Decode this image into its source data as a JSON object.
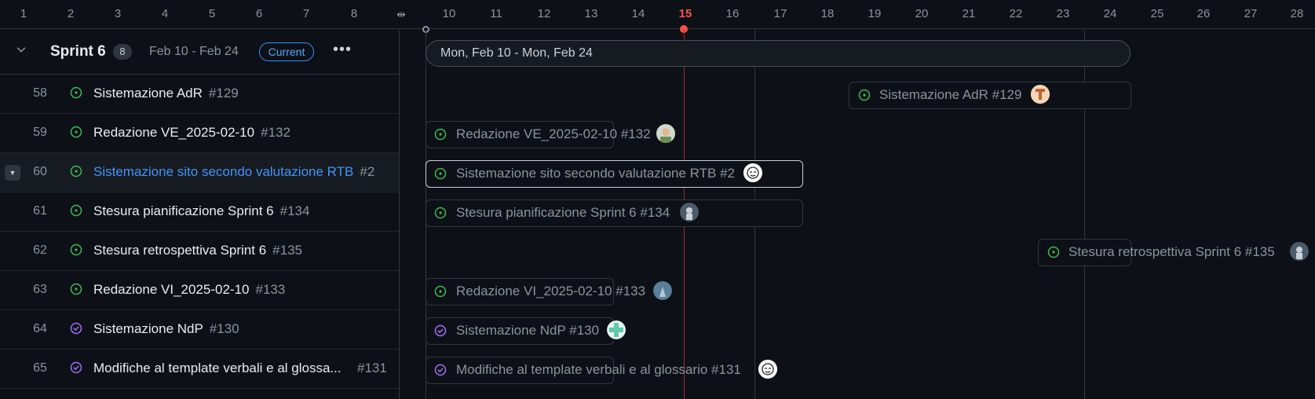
{
  "calendar": {
    "days": [
      "1",
      "2",
      "3",
      "4",
      "5",
      "6",
      "7",
      "8",
      "10",
      "11",
      "12",
      "13",
      "14",
      "15",
      "16",
      "17",
      "18",
      "19",
      "20",
      "21",
      "22",
      "23",
      "24",
      "25",
      "26",
      "27",
      "28"
    ],
    "today": "15"
  },
  "group": {
    "title": "Sprint 6",
    "count": "8",
    "date_range": "Feb 10 - Feb 24",
    "status_badge": "Current",
    "more": "•••",
    "timeline_label": "Mon, Feb 10 - Mon, Feb 24"
  },
  "items": [
    {
      "num": "58",
      "title": "Sistemazione AdR",
      "issue": "#129",
      "state": "open",
      "bar_label": "Sistemazione AdR #129"
    },
    {
      "num": "59",
      "title": "Redazione VE_2025-02-10",
      "issue": "#132",
      "state": "open",
      "bar_label": "Redazione VE_2025-02-10 #132"
    },
    {
      "num": "60",
      "title": "Sistemazione sito secondo valutazione RTB",
      "issue": "#2",
      "state": "open",
      "bar_label": "Sistemazione sito secondo valutazione RTB #2"
    },
    {
      "num": "61",
      "title": "Stesura pianificazione Sprint 6",
      "issue": "#134",
      "state": "open",
      "bar_label": "Stesura pianificazione Sprint 6 #134"
    },
    {
      "num": "62",
      "title": "Stesura retrospettiva Sprint 6",
      "issue": "#135",
      "state": "open",
      "bar_label": "Stesura retrospettiva Sprint 6 #135"
    },
    {
      "num": "63",
      "title": "Redazione VI_2025-02-10",
      "issue": "#133",
      "state": "open",
      "bar_label": "Redazione VI_2025-02-10 #133"
    },
    {
      "num": "64",
      "title": "Sistemazione NdP",
      "issue": "#130",
      "state": "closed",
      "bar_label": "Sistemazione NdP #130"
    },
    {
      "num": "65",
      "title": "Modifiche al template verbali e al glossa...",
      "issue": "#131",
      "state": "closed",
      "bar_label": "Modifiche al template verbali e al glossario #131"
    }
  ],
  "colors": {
    "open": "#3fb950",
    "closed": "#a371f7",
    "today": "#f85149",
    "link": "#4493f8"
  }
}
